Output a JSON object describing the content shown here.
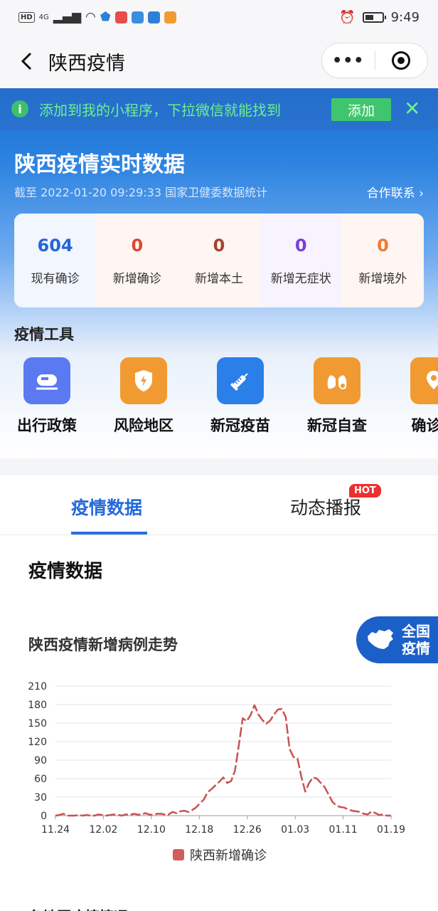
{
  "status_bar": {
    "left_badges": [
      "HD",
      "4G"
    ],
    "time": "9:49",
    "app_colors": [
      "#e94c4c",
      "#3b8de0",
      "#2f7fd6",
      "#f29a32"
    ]
  },
  "nav": {
    "back_icon": "chevron-left-icon",
    "title": "陕西疫情",
    "more_icon": "more-dots-icon",
    "close_icon": "target-close-icon"
  },
  "banner": {
    "text": "添加到我的小程序，下拉微信就能找到",
    "add_label": "添加",
    "close_glyph": "✕",
    "info_glyph": "i"
  },
  "hero": {
    "title": "陕西疫情实时数据",
    "subtitle": "截至 2022-01-20 09:29:33 国家卫健委数据统计",
    "contact": "合作联系 ›"
  },
  "stats": [
    {
      "value": "604",
      "label": "现有确诊",
      "color": "#2565d8",
      "bg": "#f1f6ff"
    },
    {
      "value": "0",
      "label": "新增确诊",
      "color": "#e0452f",
      "bg": "#fff5f2"
    },
    {
      "value": "0",
      "label": "新增本土",
      "color": "#a3452c",
      "bg": "#fff5f2"
    },
    {
      "value": "0",
      "label": "新增无症状",
      "color": "#7b3fd6",
      "bg": "#f7f3ff"
    },
    {
      "value": "0",
      "label": "新增境外",
      "color": "#f07a2a",
      "bg": "#fff5f2"
    }
  ],
  "tools": {
    "title": "疫情工具",
    "items": [
      {
        "label": "出行政策",
        "icon": "train-icon",
        "color": "#5b79f0"
      },
      {
        "label": "风险地区",
        "icon": "shield-alert-icon",
        "color": "#f29a32"
      },
      {
        "label": "新冠疫苗",
        "icon": "syringe-icon",
        "color": "#2b7fe8"
      },
      {
        "label": "新冠自查",
        "icon": "lungs-search-icon",
        "color": "#f29a32"
      },
      {
        "label": "确诊地",
        "icon": "map-pin-icon",
        "color": "#f29a32"
      }
    ]
  },
  "tabs": [
    {
      "label": "疫情数据",
      "active": true
    },
    {
      "label": "动态播报",
      "active": false,
      "badge": "HOT"
    }
  ],
  "section_title": "疫情数据",
  "national_button": {
    "label_line1": "全国",
    "label_line2": "疫情"
  },
  "chart_data": {
    "type": "line",
    "title": "陕西疫情新增病例走势",
    "xlabel": "",
    "ylabel": "",
    "ylim": [
      0,
      210
    ],
    "yticks": [
      0,
      30,
      60,
      90,
      120,
      150,
      180,
      210
    ],
    "xtick_labels": [
      "11.24",
      "12.02",
      "12.10",
      "12.18",
      "12.26",
      "01.03",
      "01.11",
      "01.19"
    ],
    "grid": true,
    "legend": "bottom",
    "series": [
      {
        "name": "陕西新增确诊",
        "color": "#c85252",
        "values": [
          0,
          1,
          3,
          0,
          0,
          0,
          1,
          0,
          1,
          0,
          0,
          2,
          1,
          0,
          1,
          2,
          1,
          0,
          2,
          1,
          3,
          2,
          1,
          4,
          2,
          1,
          3,
          3,
          2,
          2,
          6,
          4,
          7,
          8,
          6,
          9,
          13,
          20,
          26,
          38,
          43,
          49,
          55,
          62,
          53,
          56,
          73,
          115,
          158,
          153,
          163,
          179,
          164,
          155,
          149,
          154,
          164,
          172,
          173,
          160,
          108,
          95,
          93,
          63,
          39,
          53,
          62,
          60,
          53,
          46,
          34,
          22,
          16,
          14,
          13,
          10,
          8,
          7,
          6,
          3,
          2,
          7,
          4,
          1,
          2,
          0,
          0
        ]
      }
    ]
  },
  "next_section_title": "各地区疫情情况"
}
